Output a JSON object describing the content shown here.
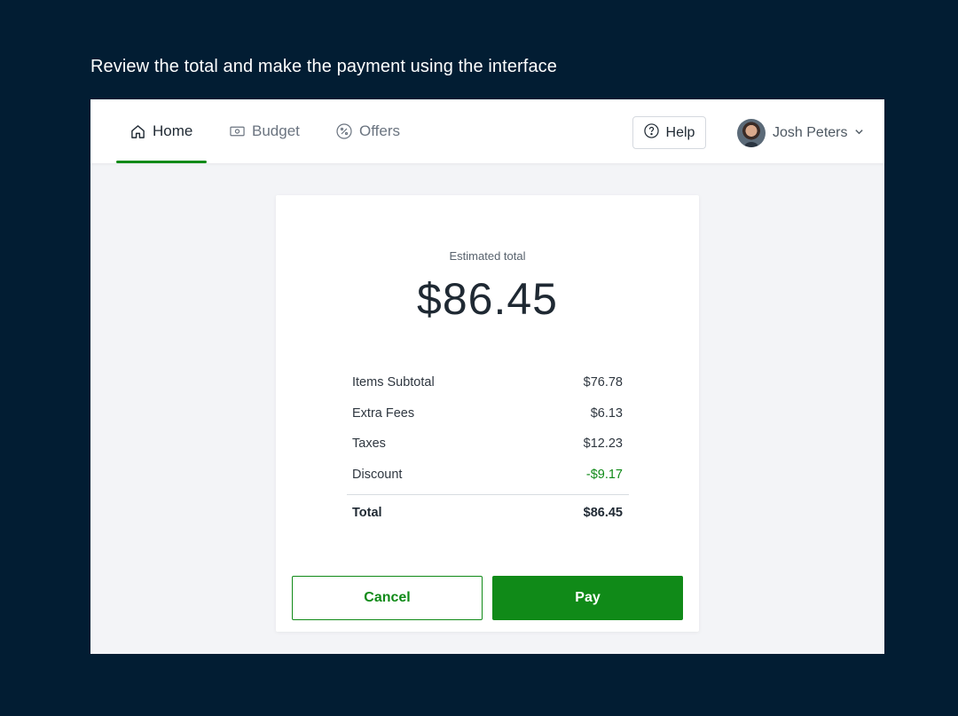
{
  "instruction": "Review the total and make the payment using the interface",
  "nav": {
    "tabs": [
      {
        "label": "Home",
        "icon": "home-icon",
        "active": true
      },
      {
        "label": "Budget",
        "icon": "money-icon",
        "active": false
      },
      {
        "label": "Offers",
        "icon": "percent-icon",
        "active": false
      }
    ],
    "help_label": "Help",
    "user_name": "Josh Peters"
  },
  "summary": {
    "estimated_label": "Estimated total",
    "estimated_amount": "$86.45",
    "lines": [
      {
        "label": "Items Subtotal",
        "value": "$76.78"
      },
      {
        "label": "Extra Fees",
        "value": "$6.13"
      },
      {
        "label": "Taxes",
        "value": "$12.23"
      },
      {
        "label": "Discount",
        "value": "-$9.17"
      }
    ],
    "total_label": "Total",
    "total_value": "$86.45"
  },
  "actions": {
    "cancel_label": "Cancel",
    "pay_label": "Pay"
  },
  "colors": {
    "background": "#021d33",
    "accent": "#108a18",
    "panel": "#f3f4f7"
  }
}
